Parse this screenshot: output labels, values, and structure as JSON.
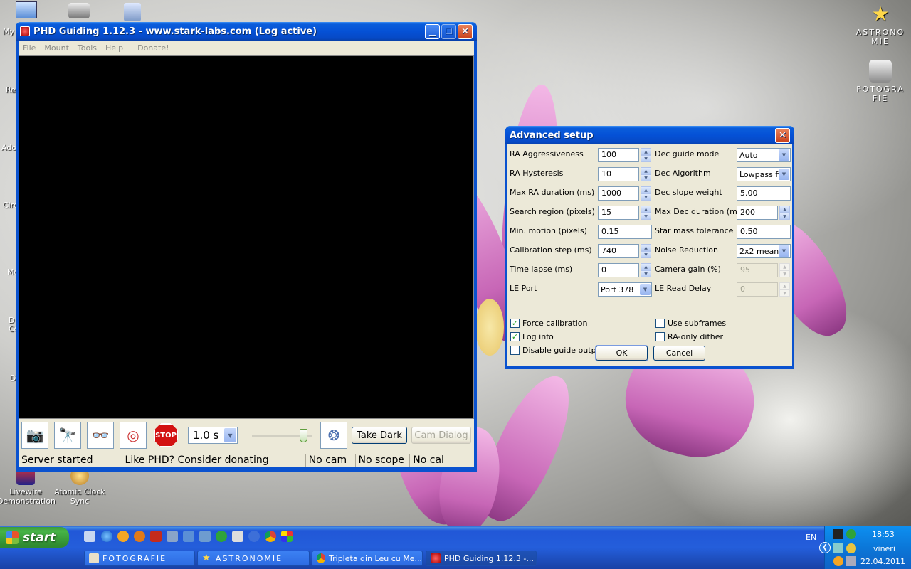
{
  "desktop": {
    "icons_left_truncated": [
      "My",
      "Re",
      "Ado",
      "Circ",
      "Mo",
      "D\nCo",
      "D"
    ],
    "icons": [
      {
        "label": "ASTRONO\nMIE",
        "icon": "star-icon"
      },
      {
        "label": "FOTOGRA\nFIE",
        "icon": "camera-icon"
      },
      {
        "label": "Livewire\nDemonstration",
        "icon": "app-shortcut-icon"
      },
      {
        "label": "Atomic Clock\nSync",
        "icon": "clock-shortcut-icon"
      }
    ]
  },
  "phd": {
    "title": "PHD Guiding 1.12.3  -  www.stark-labs.com (Log active)",
    "menu": [
      "File",
      "Mount",
      "Tools",
      "Help",
      "Donate!"
    ],
    "exposure": "1.0 s",
    "slider_fraction": 0.92,
    "take_dark_label": "Take Dark",
    "cam_dialog_label": "Cam Dialog",
    "status": {
      "server": "Server started",
      "donate": "Like PHD? Consider donating",
      "cam": "No cam",
      "scope": "No scope",
      "cal": "No cal"
    }
  },
  "advanced": {
    "title": "Advanced setup",
    "left": [
      {
        "label": "RA Aggressiveness",
        "value": "100",
        "kind": "spin"
      },
      {
        "label": "RA Hysteresis",
        "value": "10",
        "kind": "spin"
      },
      {
        "label": "Max RA duration (ms)",
        "value": "1000",
        "kind": "spin"
      },
      {
        "label": "Search region (pixels)",
        "value": "15",
        "kind": "spin"
      },
      {
        "label": "Min. motion (pixels)",
        "value": "0.15",
        "kind": "text"
      },
      {
        "label": "Calibration step (ms)",
        "value": "740",
        "kind": "spin"
      },
      {
        "label": "Time lapse (ms)",
        "value": "0",
        "kind": "spin"
      },
      {
        "label": "LE Port",
        "value": "Port 378",
        "kind": "select"
      }
    ],
    "right": [
      {
        "label": "Dec guide mode",
        "value": "Auto",
        "kind": "select"
      },
      {
        "label": "Dec Algorithm",
        "value": "Lowpass filter",
        "kind": "select"
      },
      {
        "label": "Dec slope weight",
        "value": "5.00",
        "kind": "text"
      },
      {
        "label": "Max Dec duration (ms)",
        "value": "200",
        "kind": "spin"
      },
      {
        "label": "Star mass tolerance",
        "value": "0.50",
        "kind": "text"
      },
      {
        "label": "Noise Reduction",
        "value": "2x2 mean",
        "kind": "select"
      },
      {
        "label": "Camera gain (%)",
        "value": "95",
        "kind": "spin-disabled"
      },
      {
        "label": "LE Read Delay",
        "value": "0",
        "kind": "spin-disabled"
      }
    ],
    "checks_left": [
      {
        "label": "Force calibration",
        "checked": true
      },
      {
        "label": "Log info",
        "checked": true
      },
      {
        "label": "Disable guide output",
        "checked": false
      }
    ],
    "checks_right": [
      {
        "label": "Use subframes",
        "checked": false
      },
      {
        "label": "RA-only dither",
        "checked": false
      }
    ],
    "ok": "OK",
    "cancel": "Cancel"
  },
  "taskbar": {
    "start": "start",
    "tasks": [
      {
        "label": "FOTOGRAFIE",
        "active": false
      },
      {
        "label": "ASTRONOMIE",
        "active": false
      },
      {
        "label": "Tripleta din Leu cu Me...",
        "active": false
      },
      {
        "label": "PHD Guiding 1.12.3 -...",
        "active": true
      }
    ],
    "lang": "EN",
    "time": "18:53",
    "day": "vineri",
    "date": "22.04.2011"
  }
}
